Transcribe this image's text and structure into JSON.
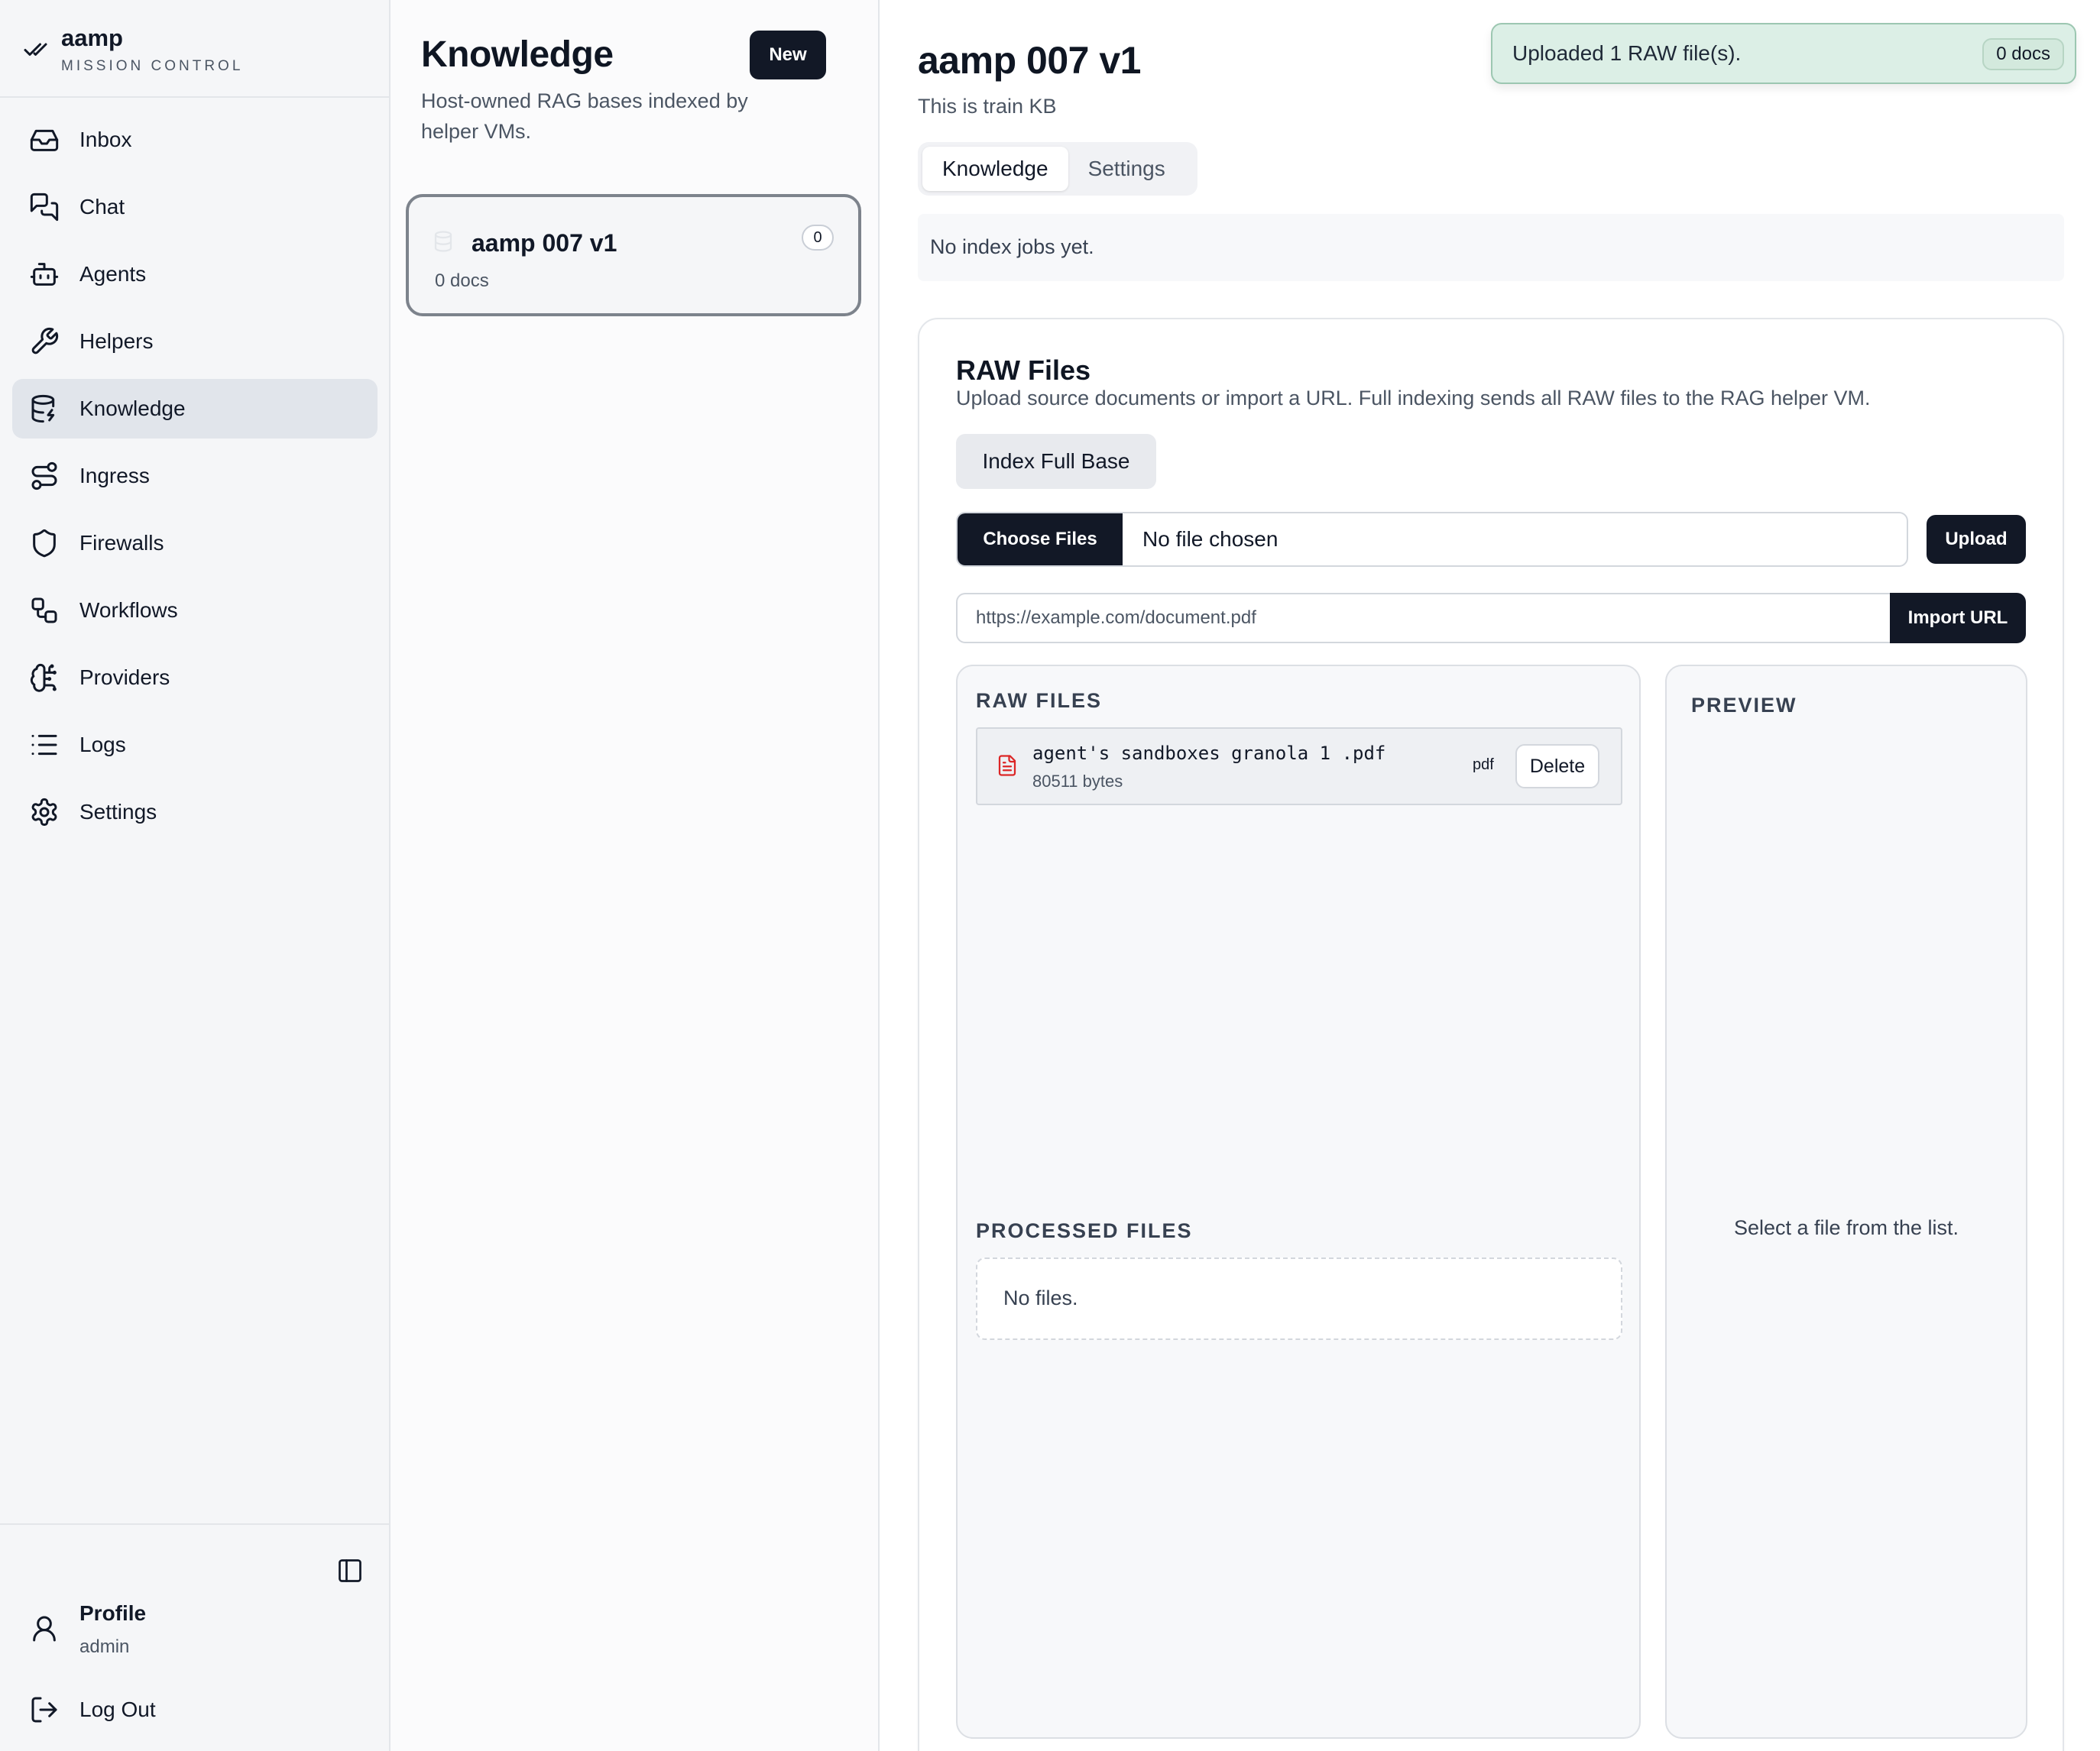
{
  "brand": {
    "name": "aamp",
    "subtitle": "MISSION CONTROL"
  },
  "nav": {
    "items": [
      {
        "label": "Inbox",
        "icon": "inbox-icon"
      },
      {
        "label": "Chat",
        "icon": "chat-icon"
      },
      {
        "label": "Agents",
        "icon": "bot-icon"
      },
      {
        "label": "Helpers",
        "icon": "wrench-icon"
      },
      {
        "label": "Knowledge",
        "icon": "database-icon",
        "active": true
      },
      {
        "label": "Ingress",
        "icon": "route-icon"
      },
      {
        "label": "Firewalls",
        "icon": "shield-icon"
      },
      {
        "label": "Workflows",
        "icon": "workflow-icon"
      },
      {
        "label": "Providers",
        "icon": "brain-icon"
      },
      {
        "label": "Logs",
        "icon": "list-icon"
      },
      {
        "label": "Settings",
        "icon": "gear-icon"
      }
    ]
  },
  "profile": {
    "name": "Profile",
    "role": "admin",
    "logout_label": "Log Out"
  },
  "knowledge_list": {
    "title": "Knowledge",
    "subtitle": "Host-owned RAG bases indexed by helper VMs.",
    "new_label": "New",
    "bases": [
      {
        "name": "aamp 007 v1",
        "docs": "0 docs",
        "count": "0"
      }
    ]
  },
  "detail": {
    "title": "aamp 007 v1",
    "description": "This is train KB",
    "tabs": [
      {
        "label": "Knowledge",
        "active": true
      },
      {
        "label": "Settings",
        "active": false
      }
    ],
    "jobs_text": "No index jobs yet."
  },
  "toast": {
    "message": "Uploaded 1 RAW file(s).",
    "badge": "0 docs"
  },
  "raw": {
    "title": "RAW Files",
    "subtitle": "Upload source documents or import a URL. Full indexing sends all RAW files to the RAG helper VM.",
    "index_label": "Index Full Base",
    "choose_label": "Choose Files",
    "no_file": "No file chosen",
    "upload_label": "Upload",
    "url_placeholder": "https://example.com/document.pdf",
    "import_label": "Import URL",
    "raw_heading": "RAW FILES",
    "files": [
      {
        "name": "agent's sandboxes granola 1 .pdf",
        "size": "80511 bytes",
        "type": "pdf",
        "delete_label": "Delete"
      }
    ],
    "processed_heading": "PROCESSED FILES",
    "processed_empty": "No files.",
    "preview_heading": "PREVIEW",
    "preview_empty": "Select a file from the list."
  },
  "colors": {
    "accent_dark": "#121826",
    "active_nav": "#e1e5eb",
    "toast_bg": "#dcefe6",
    "file_icon": "#dc2626"
  }
}
